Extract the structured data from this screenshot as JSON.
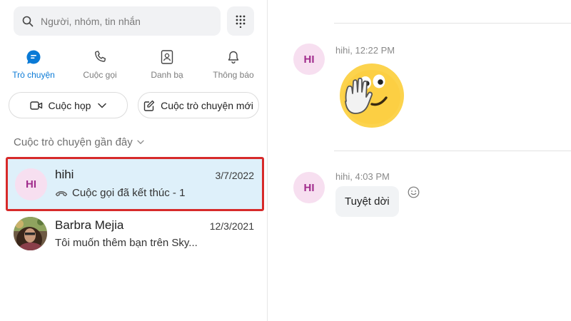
{
  "search": {
    "placeholder": "Người, nhóm, tin nhắn"
  },
  "nav": [
    {
      "label": "Trò chuyện",
      "icon": "chat-icon",
      "active": true
    },
    {
      "label": "Cuộc gọi",
      "icon": "phone-icon",
      "active": false
    },
    {
      "label": "Danh bạ",
      "icon": "contacts-icon",
      "active": false
    },
    {
      "label": "Thông báo",
      "icon": "bell-icon",
      "active": false
    }
  ],
  "actions": {
    "meeting_label": "Cuộc họp",
    "new_chat_label": "Cuộc trò chuyện mới"
  },
  "recent": {
    "title": "Cuộc trò chuyện gần đây",
    "conversations": [
      {
        "initials": "HI",
        "name": "hihi",
        "date": "3/7/2022",
        "preview": "Cuộc gọi đã kết thúc - 1"
      },
      {
        "name": "Barbra Mejia",
        "date": "12/3/2021",
        "preview": "Tôi muốn thêm bạn trên Sky..."
      }
    ]
  },
  "messages": [
    {
      "initials": "HI",
      "meta": "hihi, 12:22 PM",
      "content": "emoji-wave"
    },
    {
      "initials": "HI",
      "meta": "hihi, 4:03 PM",
      "text": "Tuyệt dời"
    }
  ],
  "colors": {
    "accent": "#0a7ad6",
    "selected_bg": "#def0fa",
    "highlight_border": "#d72a2a",
    "avatar_bg": "#f7dff0",
    "avatar_text": "#a12d8d"
  }
}
